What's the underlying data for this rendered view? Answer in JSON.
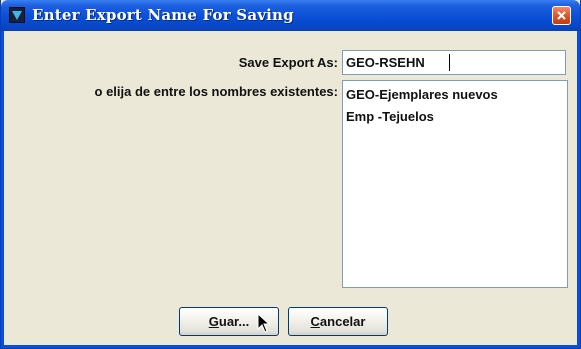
{
  "window": {
    "title": "Enter Export Name For Saving"
  },
  "form": {
    "save_as_label": "Save Export As:",
    "save_as_value": "GEO-RSEHN",
    "existing_label": "o elija de entre los nombres existentes:"
  },
  "existing_names": [
    "GEO-Ejemplares nuevos",
    "Emp -Tejuelos"
  ],
  "buttons": {
    "save": {
      "mnemonic": "G",
      "rest": "uar..."
    },
    "cancel": {
      "mnemonic": "C",
      "rest": "ancelar"
    }
  },
  "icons": {
    "app": "app-icon",
    "close": "close-icon",
    "cursor": "mouse-pointer-icon"
  },
  "colors": {
    "titlebar": "#0a4fd6",
    "close_button": "#e0552c",
    "dialog_background": "#ebe8d7"
  }
}
